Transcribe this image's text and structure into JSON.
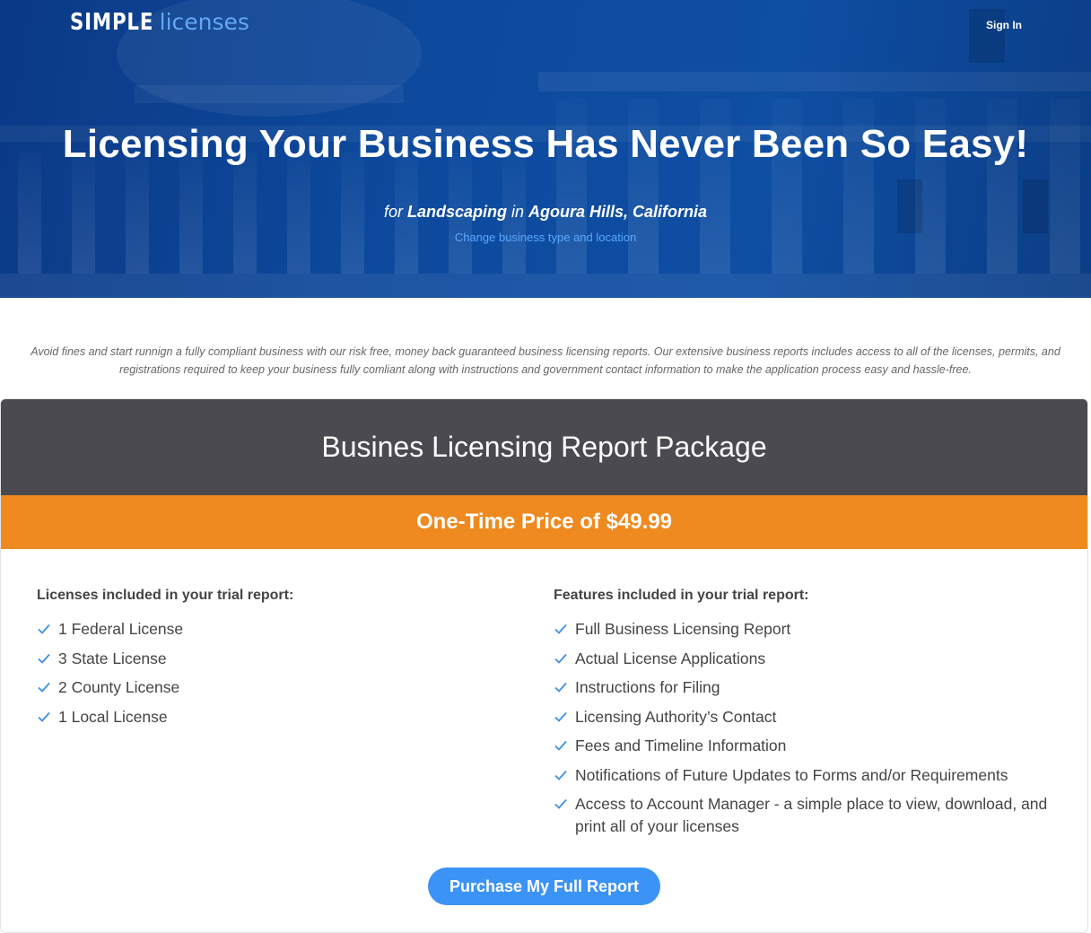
{
  "header": {
    "logo_simple": "SIMPLE",
    "logo_licenses": "licenses",
    "signin_label": "Sign In"
  },
  "hero": {
    "title": "Licensing Your Business Has Never Been So Easy!",
    "for_word": "for",
    "business_type": "Landscaping",
    "in_word": "in",
    "location": "Agoura Hills, California",
    "change_link": "Change business type and location"
  },
  "intro": {
    "text": "Avoid fines and start runnign a fully compliant business with our risk free, money back guaranteed business licensing reports. Our extensive business reports includes access to all of the licenses, permits, and registrations required to keep your business fully comliant along with instructions and government contact information to make the application process easy and hassle-free."
  },
  "package": {
    "title": "Busines Licensing Report Package",
    "price_label": "One-Time Price of $49.99",
    "licenses_heading": "Licenses included in your trial report:",
    "licenses": [
      "1 Federal License",
      "3 State License",
      "2 County License",
      "1 Local License"
    ],
    "features_heading": "Features included in your trial report:",
    "features": [
      "Full Business Licensing Report",
      "Actual License Applications",
      "Instructions for Filing",
      "Licensing Authority’s Contact",
      "Fees and Timeline Information",
      "Notifications of Future Updates to Forms and/or Requirements",
      "Access to Account Manager - a simple place to view, download, and print all of your licenses"
    ],
    "purchase_label": "Purchase My Full Report"
  },
  "colors": {
    "hero_blue": "#0d4a9e",
    "link_blue": "#5aa7ff",
    "header_gray": "#4a4a50",
    "price_orange": "#ee8a1f",
    "button_blue": "#3b93f5",
    "check_blue": "#3b8fe6"
  },
  "icons": {
    "check": "check-icon"
  }
}
